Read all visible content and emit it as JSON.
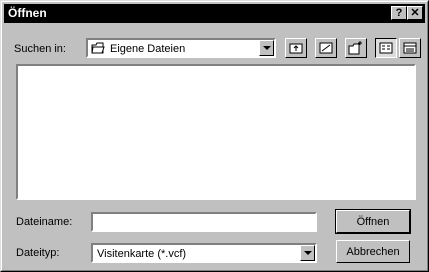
{
  "window": {
    "title": "Öffnen",
    "help_glyph": "?",
    "close_glyph": "✕"
  },
  "lookin": {
    "label": "Suchen in:",
    "value": "Eigene Dateien"
  },
  "toolbar": {
    "buttons": [
      "up-folder",
      "desktop",
      "new-folder",
      "list-view",
      "details-view"
    ]
  },
  "filename": {
    "label": "Dateiname:",
    "value": ""
  },
  "filetype": {
    "label": "Dateityp:",
    "value": "Visitenkarte (*.vcf)"
  },
  "buttons": {
    "open": "Öffnen",
    "cancel": "Abbrechen"
  }
}
